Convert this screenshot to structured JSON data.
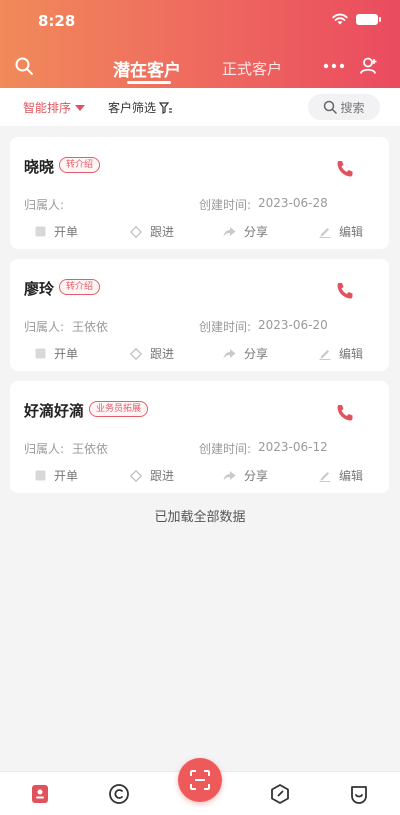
{
  "status_bar": {
    "time": "8:28"
  },
  "header": {
    "tabs": [
      {
        "label": "潜在客户",
        "active": true
      },
      {
        "label": "正式客户",
        "active": false
      }
    ],
    "icons": {
      "left": "search-icon",
      "more": "more-icon",
      "right": "add-user-icon"
    }
  },
  "filter_bar": {
    "sort_label": "智能排序",
    "filter_label": "客户筛选",
    "search_label": "搜索"
  },
  "customers": [
    {
      "name": "晓晓",
      "badge": "转介绍",
      "owner_label": "归属人:",
      "owner": "",
      "created_label": "创建时间:",
      "created": "2023-06-28"
    },
    {
      "name": "廖玲",
      "badge": "转介绍",
      "owner_label": "归属人:",
      "owner": "王依依",
      "created_label": "创建时间:",
      "created": "2023-06-20"
    },
    {
      "name": "好滴好滴",
      "badge": "业务员拓展",
      "owner_label": "归属人:",
      "owner": "王依依",
      "created_label": "创建时间:",
      "created": "2023-06-12"
    }
  ],
  "card_actions": [
    "开单",
    "跟进",
    "分享",
    "编辑"
  ],
  "list_footer": "已加载全部数据",
  "colors": {
    "accent": "#e0535c",
    "header_start": "#f08a5a",
    "header_end": "#ea4b5f"
  }
}
